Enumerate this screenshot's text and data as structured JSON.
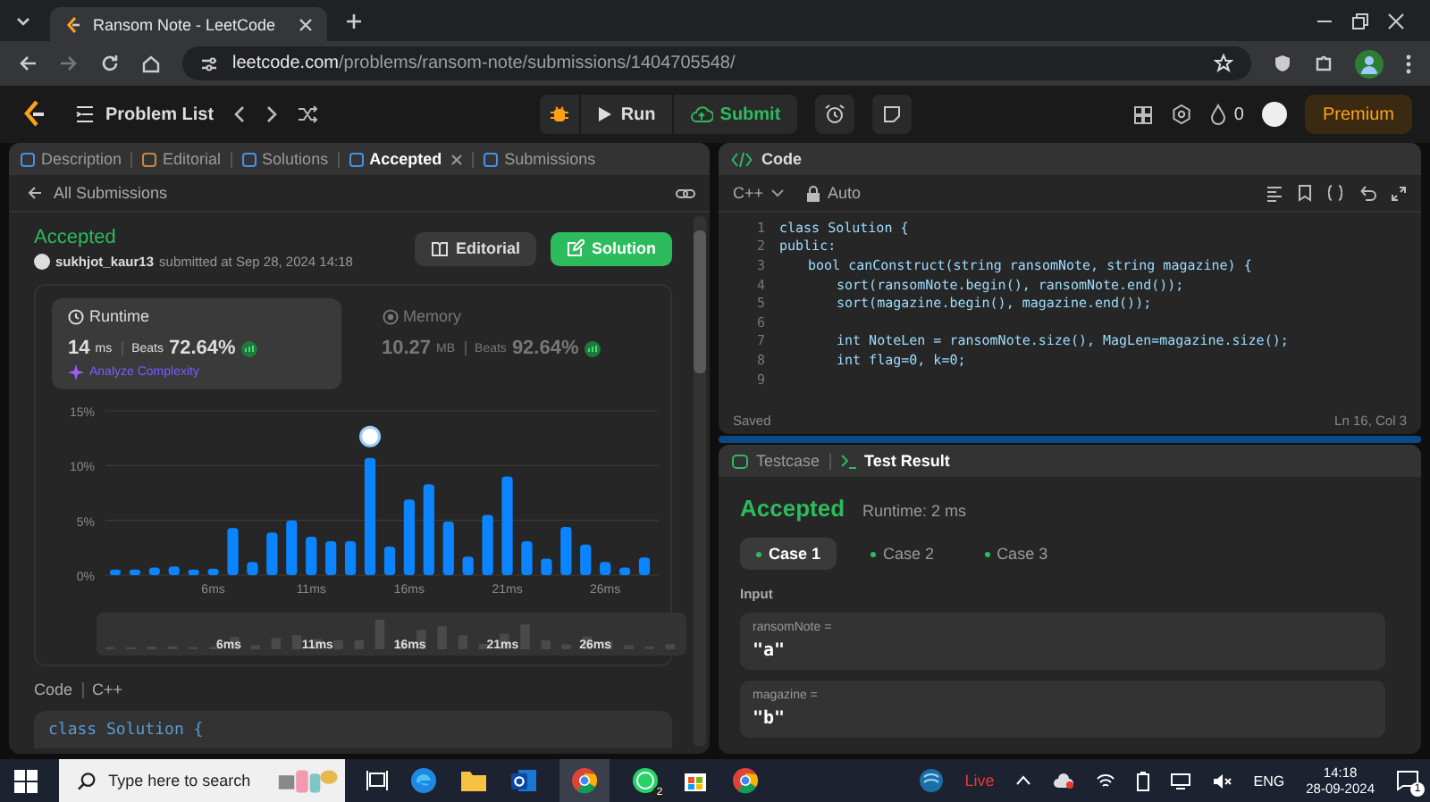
{
  "browser": {
    "tab_title": "Ransom Note - LeetCode",
    "url_host": "leetcode.com",
    "url_path": "/problems/ransom-note/submissions/1404705548/"
  },
  "nav": {
    "title": "Problem List",
    "run": "Run",
    "submit": "Submit",
    "streak": "0",
    "premium": "Premium"
  },
  "left_tabs": [
    {
      "label": "Description",
      "selected": false,
      "closable": false
    },
    {
      "label": "Editorial",
      "selected": false,
      "closable": false
    },
    {
      "label": "Solutions",
      "selected": false,
      "closable": false
    },
    {
      "label": "Accepted",
      "selected": true,
      "closable": true
    },
    {
      "label": "Submissions",
      "selected": false,
      "closable": false
    }
  ],
  "submission": {
    "back": "All Submissions",
    "status": "Accepted",
    "user": "sukhjot_kaur13",
    "submitted": "submitted at Sep 28, 2024 14:18",
    "editorial_button": "Editorial",
    "solution_button": "Solution"
  },
  "metrics": [
    {
      "kind": "runtime",
      "label": "Runtime",
      "value": "14",
      "unit": "ms",
      "beats_label": "Beats",
      "beats": "72.64%",
      "analyze": "Analyze Complexity",
      "selected": true
    },
    {
      "kind": "memory",
      "label": "Memory",
      "value": "10.27",
      "unit": "MB",
      "beats_label": "Beats",
      "beats": "92.64%",
      "selected": false
    }
  ],
  "chart_data": {
    "type": "bar",
    "x": [
      1,
      2,
      3,
      4,
      5,
      6,
      7,
      8,
      9,
      10,
      11,
      12,
      13,
      14,
      15,
      16,
      17,
      18,
      19,
      20,
      21,
      22,
      23,
      24,
      25,
      26,
      27,
      28
    ],
    "xlim": [
      0.5,
      28.5
    ],
    "series": [
      {
        "color": "#0a84ff",
        "values": [
          0.5,
          0.5,
          0.7,
          0.8,
          0.5,
          0.6,
          4.3,
          1.2,
          3.9,
          5.0,
          3.5,
          3.1,
          3.1,
          10.7,
          2.6,
          6.9,
          8.3,
          4.9,
          1.7,
          5.5,
          9.0,
          3.1,
          1.5,
          4.4,
          2.8,
          1.2,
          0.7,
          1.6
        ]
      }
    ],
    "ylim": [
      0,
      15
    ],
    "yticks": [
      {
        "value": 0,
        "label": "0%"
      },
      {
        "value": 5,
        "label": "5%"
      },
      {
        "value": 10,
        "label": "10%"
      },
      {
        "value": 15,
        "label": "15%"
      }
    ],
    "xticks": [
      {
        "value": 6,
        "label": "6ms"
      },
      {
        "value": 11,
        "label": "11ms"
      },
      {
        "value": 16,
        "label": "16ms"
      },
      {
        "value": 21,
        "label": "21ms"
      },
      {
        "value": 26,
        "label": "26ms"
      }
    ]
  },
  "overview_labels": [
    "6ms",
    "11ms",
    "16ms",
    "21ms",
    "26ms"
  ],
  "code_preview": {
    "label": "Code",
    "language": "C++",
    "first_line": "class Solution {"
  },
  "editor": {
    "title": "Code",
    "language": "C++",
    "mode": "Auto",
    "lines": [
      {
        "number": "1",
        "text": "class Solution {"
      },
      {
        "number": "2",
        "text": "public:",
        "children": [
          {
            "number": "3",
            "text": "bool canConstruct(string ransomNote, string magazine) {",
            "children": [
              {
                "number": "4",
                "text": "sort(ransomNote.begin(), ransomNote.end());"
              },
              {
                "number": "5",
                "text": "sort(magazine.begin(), magazine.end());"
              },
              {
                "number": "6"
              },
              {
                "number": "7",
                "text": "int NoteLen = ransomNote.size(), MagLen=magazine.size();"
              },
              {
                "number": "8",
                "text": "int flag=0, k=0;"
              },
              {
                "number": "9"
              }
            ]
          }
        ]
      }
    ],
    "status": "Saved",
    "cursor": "Ln 16, Col 3"
  },
  "result": {
    "tabs": [
      {
        "label": "Testcase",
        "selected": false
      },
      {
        "label": "Test Result",
        "selected": true
      }
    ],
    "verdict": "Accepted",
    "runtime": "Runtime: 2 ms",
    "cases": [
      {
        "label": "Case 1",
        "selected": true
      },
      {
        "label": "Case 2",
        "selected": false
      },
      {
        "label": "Case 3",
        "selected": false
      }
    ],
    "input_label": "Input",
    "inputs": [
      {
        "name": "ransomNote =",
        "value": "\"a\""
      },
      {
        "name": "magazine =",
        "value": "\"b\""
      }
    ]
  },
  "taskbar": {
    "search_placeholder": "Type here to search",
    "whatsapp_badge": "2",
    "live": "Live",
    "language": "ENG",
    "time": "14:18",
    "date": "28-09-2024",
    "notifications": "1"
  }
}
